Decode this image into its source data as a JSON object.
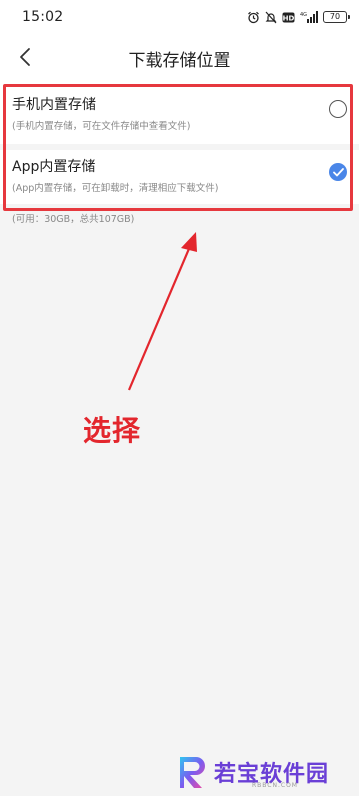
{
  "status_bar": {
    "time": "15:02",
    "battery": "70",
    "icons": [
      "alarm-icon",
      "mute-icon",
      "hd-icon",
      "signal-icon",
      "battery-icon"
    ]
  },
  "header": {
    "back_icon": "chevron-left-icon",
    "title": "下载存储位置"
  },
  "storage_options": [
    {
      "title": "手机内置存储",
      "description": "(手机内置存储，可在文件存储中查看文件)",
      "selected": false
    },
    {
      "title": "App内置存储",
      "description": "(App内置存储，可在卸载时，清理相应下载文件)",
      "selected": true
    }
  ],
  "storage_info": "(可用：30GB，总共107GB)",
  "annotation": {
    "label": "选择",
    "color": "#e3262d"
  },
  "watermark": {
    "text": "若宝软件园",
    "sub": "RBBCN.COM"
  },
  "colors": {
    "accent": "#4a86e8",
    "highlight": "#e6383e",
    "background": "#f4f4f4"
  }
}
